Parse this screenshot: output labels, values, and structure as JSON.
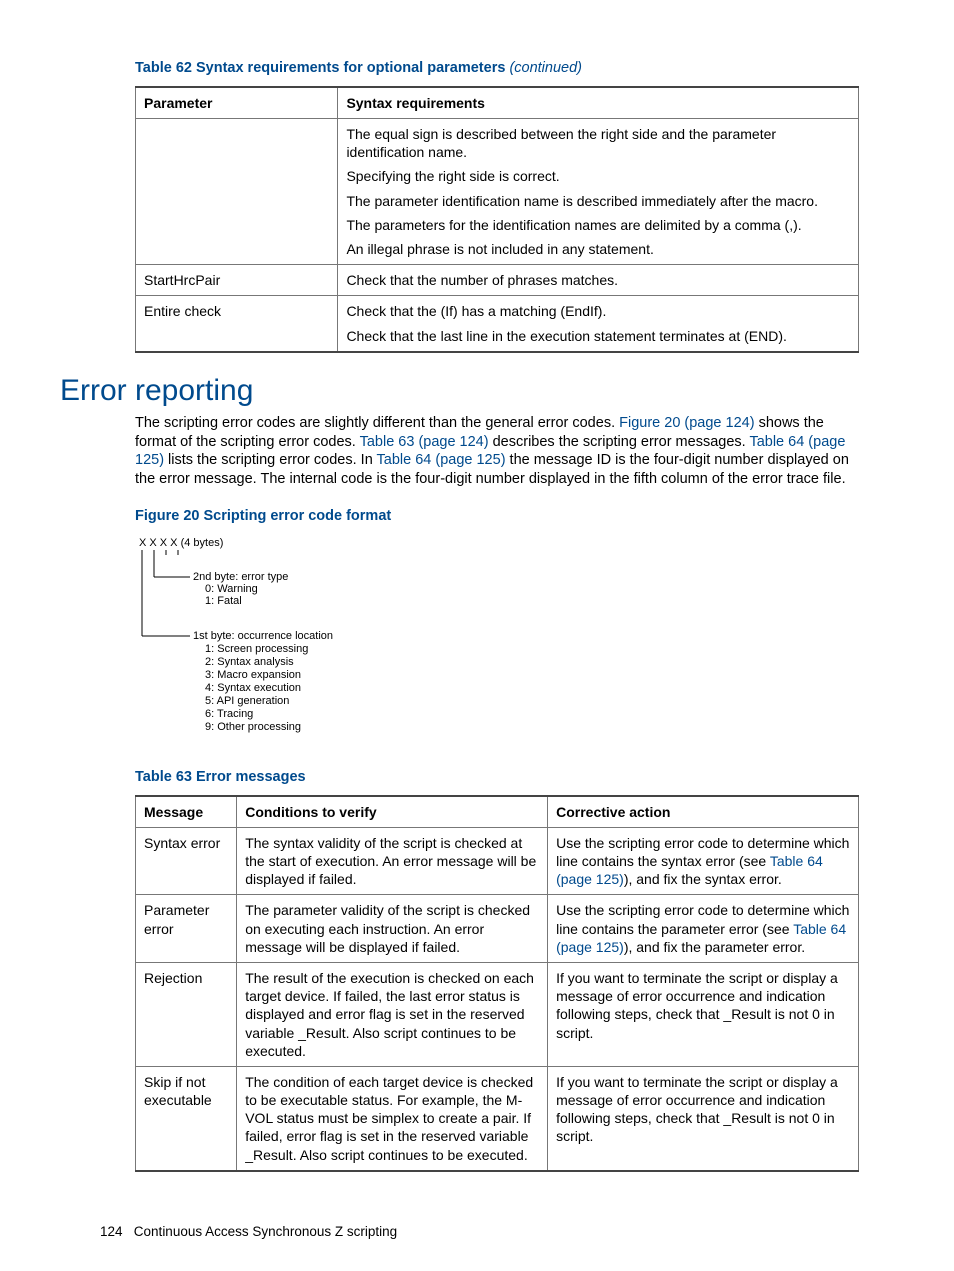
{
  "tables": {
    "t62": {
      "caption_main": "Table 62 Syntax requirements for optional parameters ",
      "caption_cont": "(continued)",
      "headers": [
        "Parameter",
        "Syntax requirements"
      ],
      "rows": [
        {
          "c0": "",
          "c1": [
            "The equal sign is described between the right side and the parameter identification name.",
            "Specifying the right side is correct.",
            "The parameter identification name is described immediately after the macro.",
            "The parameters for the identification names are delimited by a comma (,).",
            "An illegal phrase is not included in any statement."
          ]
        },
        {
          "c0": "StartHrcPair",
          "c1": [
            "Check that the number of phrases matches."
          ]
        },
        {
          "c0": "Entire check",
          "c1": [
            "Check that the (If) has a matching (EndIf).",
            "Check that the last line in the execution statement terminates at (END)."
          ]
        }
      ]
    },
    "t63": {
      "caption": "Table 63 Error messages",
      "headers": [
        "Message",
        "Conditions to verify",
        "Corrective action"
      ],
      "rows": [
        {
          "c0": "Syntax error",
          "c1": "The syntax validity of the script is checked at the start of execution. An error message will be displayed if failed.",
          "c2_pre": "Use the scripting error code to determine which line contains the syntax error (see ",
          "c2_link": "Table 64 (page 125)",
          "c2_post": "), and fix the syntax error."
        },
        {
          "c0": "Parameter error",
          "c1": "The parameter validity of the script is checked on executing each instruction. An error message will be displayed if failed.",
          "c2_pre": "Use the scripting error code to determine which line contains the parameter error (see ",
          "c2_link": "Table 64 (page 125)",
          "c2_post": "), and fix the parameter error."
        },
        {
          "c0": "Rejection",
          "c1": "The result of the execution is checked on each target device. If failed, the last error status is displayed and error flag is set in the reserved variable _Result. Also script continues to be executed.",
          "c2_pre": "If you want to terminate the script or display a message of error occurrence and indication following steps, check that _Result is not 0 in script.",
          "c2_link": "",
          "c2_post": ""
        },
        {
          "c0": "Skip if not executable",
          "c1": "The condition of each target device is checked to be executable status. For example, the M-VOL status must be simplex to create a pair. If failed, error flag is set in the reserved variable _Result. Also script continues to be executed.",
          "c2_pre": "If you want to terminate the script or display a message of error occurrence and indication following steps, check that _Result is not 0 in script.",
          "c2_link": "",
          "c2_post": ""
        }
      ]
    }
  },
  "section_heading": "Error reporting",
  "body_text": {
    "t1": "The scripting error codes are slightly different than the general error codes. ",
    "l1": "Figure 20 (page 124)",
    "t2": " shows the format of the scripting error codes. ",
    "l2": "Table 63 (page 124)",
    "t3": " describes the scripting error messages. ",
    "l3": "Table 64 (page 125)",
    "t4": " lists the scripting error codes. In ",
    "l4": "Table 64 (page 125)",
    "t5": " the message ID is the four-digit number displayed on the error message. The internal code is the four-digit number displayed in the fifth column of the error trace file."
  },
  "figure": {
    "caption": "Figure 20 Scripting error code format",
    "top_label": "X X X X (4 bytes)",
    "group2": {
      "title": "2nd byte: error type",
      "items": [
        "0: Warning",
        "1: Fatal"
      ]
    },
    "group1": {
      "title": "1st byte: occurrence location",
      "items": [
        "1: Screen processing",
        "2: Syntax analysis",
        "3: Macro expansion",
        "4: Syntax execution",
        "5: API generation",
        "6: Tracing",
        "9: Other processing"
      ]
    }
  },
  "footer": {
    "page_no": "124",
    "title": "Continuous Access Synchronous Z scripting"
  }
}
